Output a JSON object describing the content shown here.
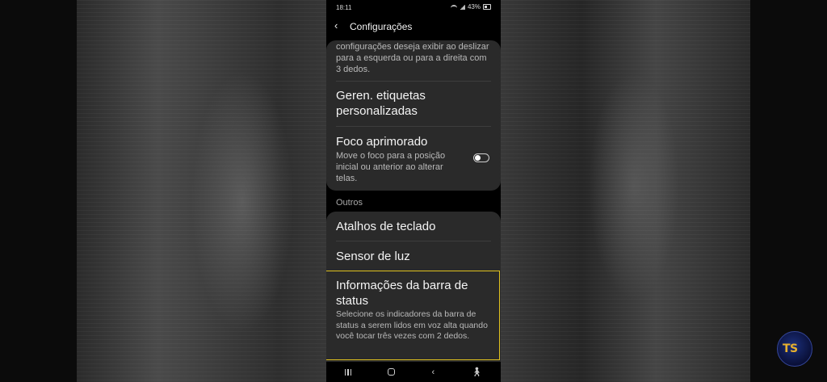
{
  "status_bar": {
    "time": "18:11",
    "battery": "43%"
  },
  "app_bar": {
    "title": "Configurações"
  },
  "card1": {
    "truncated_description": "configurações deseja exibir ao deslizar para a esquerda ou para a direita com 3 dedos.",
    "item_custom_labels": {
      "title": "Geren. etiquetas personalizadas"
    },
    "item_enhanced_focus": {
      "title": "Foco aprimorado",
      "description": "Move o foco para a posição inicial ou anterior ao alterar telas.",
      "toggle_on": false
    }
  },
  "section_other": {
    "label": "Outros"
  },
  "card2": {
    "item_keyboard_shortcuts": {
      "title": "Atalhos de teclado"
    },
    "item_light_sensor": {
      "title": "Sensor de luz"
    },
    "item_status_bar_info": {
      "title": "Informações da barra de status",
      "description": "Selecione os indicadores da barra de status a serem lidos em voz alta quando você tocar três vezes com 2 dedos.",
      "highlight_color": "#e0c21f"
    }
  },
  "nav_bar": {
    "icons": [
      "recent-apps-icon",
      "home-icon",
      "back-icon",
      "accessibility-icon"
    ]
  },
  "watermark": {
    "text": "TS"
  }
}
